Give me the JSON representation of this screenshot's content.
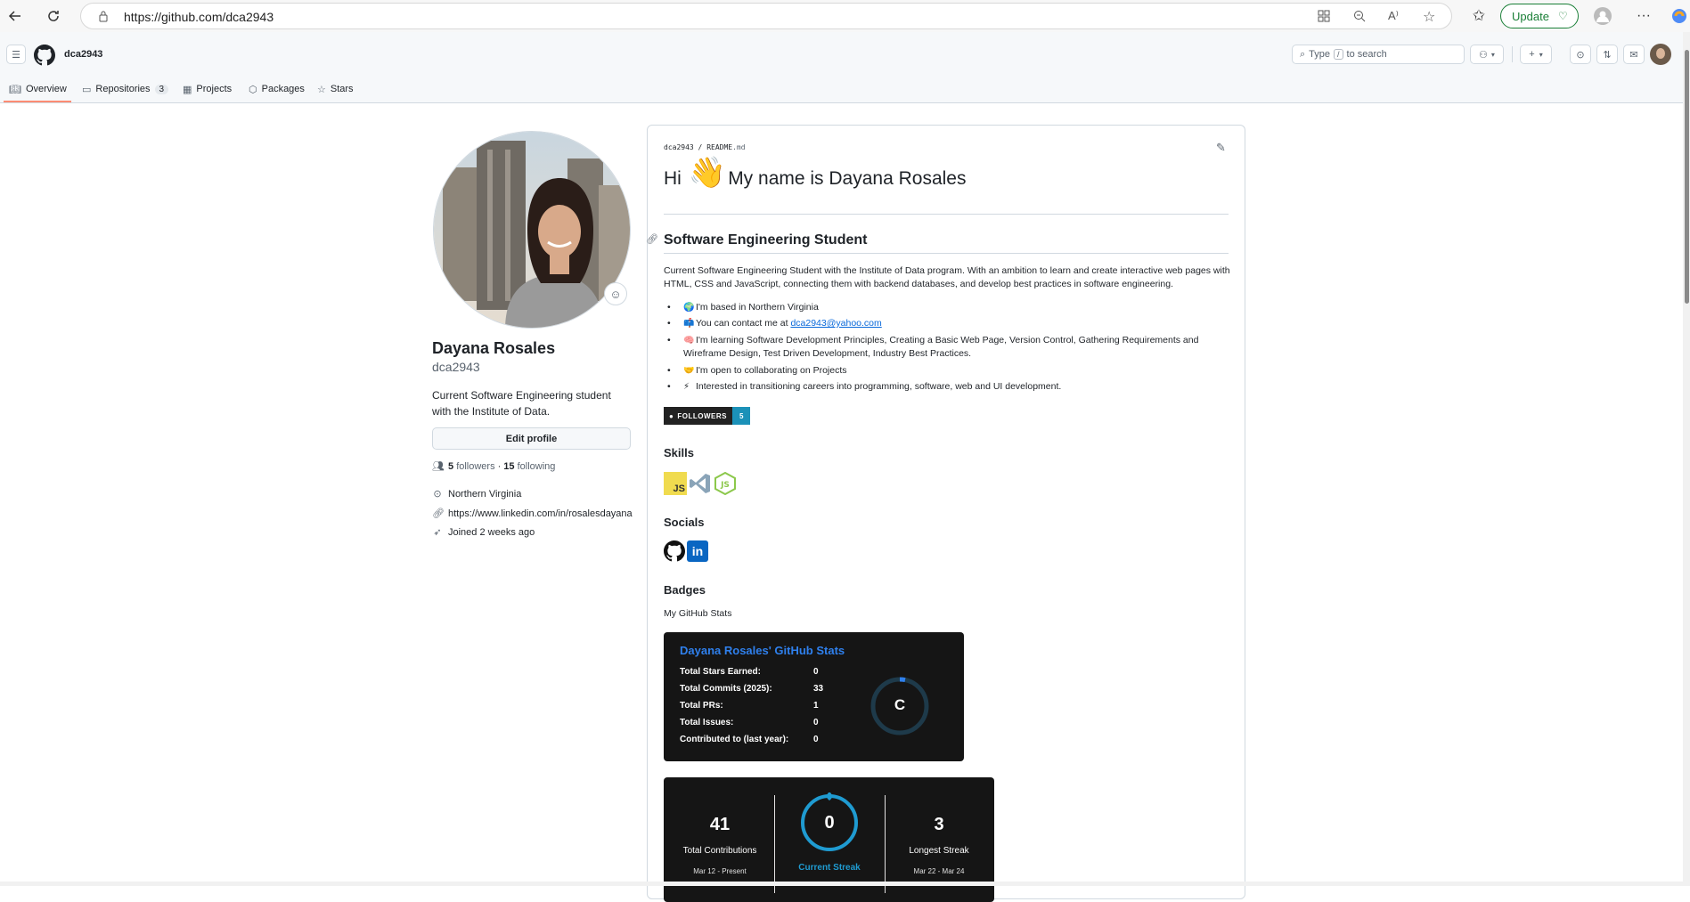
{
  "browser": {
    "url": "https://github.com/dca2943",
    "update_label": "Update"
  },
  "header": {
    "username": "dca2943",
    "search_placeholder_pre": "Type",
    "search_key": "/",
    "search_placeholder_post": "to search"
  },
  "tabs": {
    "overview": "Overview",
    "repositories": "Repositories",
    "repositories_count": "3",
    "projects": "Projects",
    "packages": "Packages",
    "stars": "Stars"
  },
  "profile": {
    "name": "Dayana Rosales",
    "login": "dca2943",
    "bio": "Current Software Engineering student with the Institute of Data.",
    "edit_label": "Edit profile",
    "followers_count": "5",
    "followers_label": "followers",
    "separator": "·",
    "following_count": "15",
    "following_label": "following",
    "location": "Northern Virginia",
    "website": "https://www.linkedin.com/in/rosalesdayana",
    "joined": "Joined 2 weeks ago"
  },
  "readme": {
    "crumb_user": "dca2943",
    "crumb_sep": "/",
    "crumb_file": "README",
    "crumb_ext": ".md",
    "h1_pre": "Hi",
    "h1_emoji": "👋",
    "h1_post": "My name is Dayana Rosales",
    "h2": "Software Engineering Student",
    "paragraph": "Current Software Engineering Student with the Institute of Data program. With an ambition to learn and create interactive web pages with HTML, CSS and JavaScript, connecting them with backend databases, and develop best practices in software engineering.",
    "list": [
      {
        "emoji": "🌍",
        "text": "I'm based in Northern Virginia"
      },
      {
        "emoji": "📫",
        "text": "You can contact me at ",
        "link": "dca2943@yahoo.com"
      },
      {
        "emoji": "🧠",
        "text": "I'm learning Software Development Principles, Creating a Basic Web Page, Version Control, Gathering Requirements and Wireframe Design, Test Driven Development, Industry Best Practices."
      },
      {
        "emoji": "🤝",
        "text": "I'm open to collaborating on Projects"
      },
      {
        "emoji": "⚡",
        "text": "Interested in transitioning careers into programming, software, web and UI development."
      }
    ],
    "followers_badge_label": "FOLLOWERS",
    "followers_badge_value": "5",
    "skills_heading": "Skills",
    "skills_js": "JS",
    "skills_node": "JS",
    "socials_heading": "Socials",
    "socials_linkedin": "in",
    "badges_heading": "Badges",
    "stats_caption": "My GitHub Stats"
  },
  "stats_card": {
    "title": "Dayana Rosales' GitHub Stats",
    "rows": [
      {
        "label": "Total Stars Earned:",
        "value": "0"
      },
      {
        "label": "Total Commits (2025):",
        "value": "33"
      },
      {
        "label": "Total PRs:",
        "value": "1"
      },
      {
        "label": "Total Issues:",
        "value": "0"
      },
      {
        "label": "Contributed to (last year):",
        "value": "0"
      }
    ],
    "rank": "C"
  },
  "streak_card": {
    "total": "41",
    "total_label": "Total Contributions",
    "total_range": "Mar 12 - Present",
    "current": "0",
    "current_label": "Current Streak",
    "longest": "3",
    "longest_label": "Longest Streak",
    "longest_range": "Mar 22 - Mar 24"
  },
  "colors": {
    "accent_tab": "#fd8c73",
    "link": "#0969da",
    "stats_title": "#2f80ed",
    "streak_ring": "#1f9bd1",
    "card_bg": "#151515"
  }
}
